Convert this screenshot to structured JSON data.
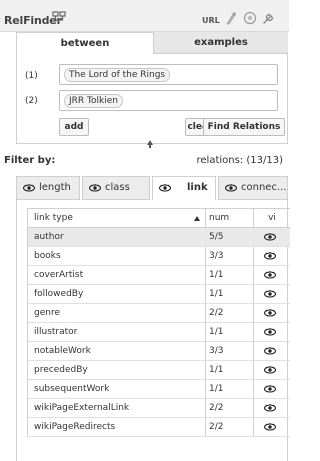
{
  "app": {
    "title": "RelFinder",
    "url_label": "URL"
  },
  "tabs": [
    {
      "label": "between",
      "active": true
    },
    {
      "label": "examples",
      "active": false
    }
  ],
  "query": {
    "rows": [
      {
        "number": "(1)",
        "entity": "The Lord of the Rings"
      },
      {
        "number": "(2)",
        "entity": "JRR Tolkien"
      }
    ],
    "buttons": {
      "add": "add",
      "clear": "clear",
      "find": "Find Relations"
    }
  },
  "filter": {
    "label": "Filter by:",
    "relations_text": "relations: (13/13)",
    "tabs": [
      {
        "label": "length",
        "active": false
      },
      {
        "label": "class",
        "active": false
      },
      {
        "label": "link",
        "active": true
      },
      {
        "label": "connec...",
        "active": false
      }
    ]
  },
  "table": {
    "headers": {
      "type": "link type",
      "num": "num",
      "vis": "vi"
    },
    "rows": [
      {
        "type": "author",
        "num": "5/5",
        "selected": true
      },
      {
        "type": "books",
        "num": "3/3"
      },
      {
        "type": "coverArtist",
        "num": "1/1"
      },
      {
        "type": "followedBy",
        "num": "1/1"
      },
      {
        "type": "genre",
        "num": "2/2"
      },
      {
        "type": "illustrator",
        "num": "1/1"
      },
      {
        "type": "notableWork",
        "num": "3/3"
      },
      {
        "type": "precededBy",
        "num": "1/1"
      },
      {
        "type": "subsequentWork",
        "num": "1/1"
      },
      {
        "type": "wikiPageExternalLink",
        "num": "2/2"
      },
      {
        "type": "wikiPageRedirects",
        "num": "2/2"
      }
    ]
  },
  "icons": {
    "flow": "flow-icon",
    "brush": "brush-icon",
    "help": "help-icon",
    "wrench": "wrench-icon",
    "eye": "eye-icon",
    "sort": "sort-asc-icon"
  }
}
